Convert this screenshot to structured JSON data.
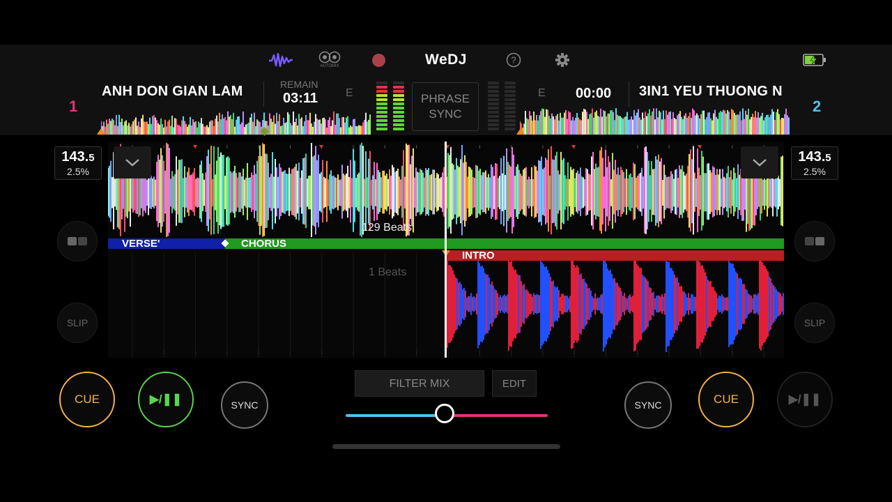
{
  "app": {
    "logo": "WeDJ",
    "automix_label": "AUTOMIX"
  },
  "colors": {
    "deck1": "#e8307a",
    "deck2": "#4fc2ee",
    "cue": "#f5b24a",
    "play": "#59d64a",
    "intro": "#b81f1f",
    "verse": "#1020a8",
    "chorus": "#1f9a1f"
  },
  "deck1": {
    "number": "1",
    "title": "ANH DON GIAN LAM",
    "remain_label": "REMAIN",
    "time": "03:11",
    "e_label": "E",
    "bpm_main": "143.",
    "bpm_decimal": "5",
    "pitch": "2.5%",
    "beats_label": "129 Beats",
    "sections": {
      "verse": "VERSE'",
      "chorus": "CHORUS"
    },
    "buttons": {
      "cue": "CUE",
      "play_pause": "▶/❚❚",
      "sync": "SYNC",
      "slip": "SLIP"
    }
  },
  "deck2": {
    "number": "2",
    "title": "3IN1 YEU THUONG N",
    "e_label": "E",
    "time": "00:00",
    "bpm_main": "143.",
    "bpm_decimal": "5",
    "pitch": "2.5%",
    "beats_label": "1 Beats",
    "sections": {
      "intro": "INTRO"
    },
    "buttons": {
      "cue": "CUE",
      "play_pause": "▶/❚❚",
      "sync": "SYNC",
      "slip": "SLIP"
    }
  },
  "center": {
    "phrase_line1": "PHRASE",
    "phrase_line2": "SYNC",
    "filter_mix": "FILTER MIX",
    "edit": "EDIT",
    "crossfader": 0.49
  }
}
